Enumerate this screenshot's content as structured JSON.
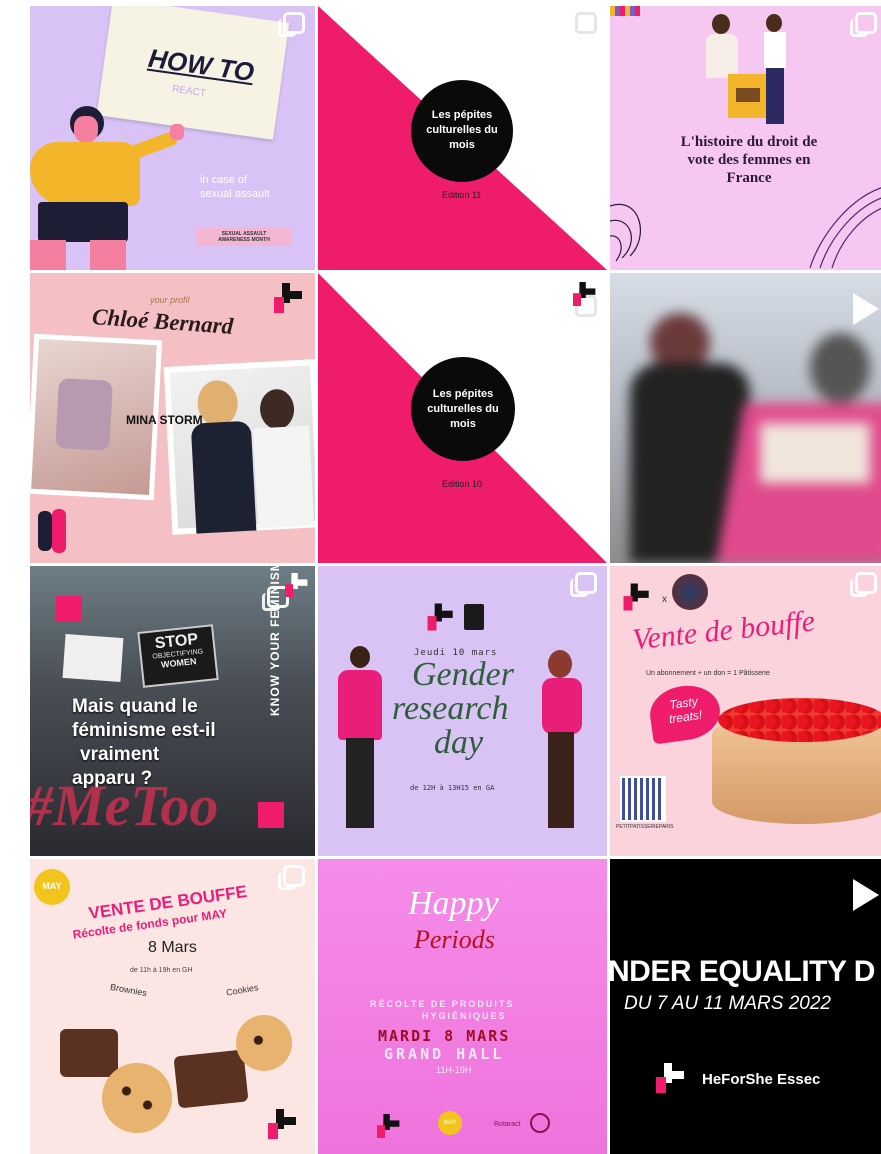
{
  "posts": [
    {
      "title": "HOW TO",
      "sub": "REACT",
      "line1": "in case of",
      "line2": "sexual assault",
      "badge1": "SEXUAL ASSAULT",
      "badge2": "AWARENESS MONTH"
    },
    {
      "title1": "Les pépites",
      "title2": "culturelles du",
      "title3": "mois",
      "edition": "Edition 11"
    },
    {
      "title1": "L'histoire du droit de",
      "title2": "vote des femmes en",
      "title3": "France"
    },
    {
      "kicker": "your profil",
      "name": "Chloé Bernard",
      "tag": "MINA STORM"
    },
    {
      "title1": "Les pépites",
      "title2": "culturelles du",
      "title3": "mois",
      "edition": "Edition 10"
    },
    {},
    {
      "l1": "Mais quand le",
      "l2": "féminisme est-il",
      "l3": "vraiment",
      "l4": "apparu ?",
      "side": "KNOW YOUR FEMINISM",
      "sign1": "STOP",
      "sign2": "OBJECTIFYING",
      "sign3": "WOMEN",
      "bigtag": "#MeToo"
    },
    {
      "date": "Jeudi 10 mars",
      "t1": "Gender",
      "t2": "research",
      "t3": "day",
      "time": "de 12H à 13H15 en GA"
    },
    {
      "title": "Vente de bouffe",
      "sub": "Un abonnement + un don = 1 Pâtisserie",
      "badge1": "Tasty",
      "badge2": "treats!",
      "x": "x",
      "credit": "PETITPATISSERIEPARIS"
    },
    {
      "badge": "MAY",
      "t1": "VENTE DE BOUFFE",
      "t2": "Récolte de fonds pour MAY",
      "date": "8 Mars",
      "time": "de 11h à 19h en GH",
      "lab1": "Brownies",
      "lab2": "Cookies"
    },
    {
      "t1": "Happy",
      "t2": "Periods",
      "s1": "RÉCOLTE DE PRODUITS",
      "s2": "HYGIÉNIQUES",
      "d1": "MARDI 8 MARS",
      "d2": "GRAND HALL",
      "time": "11H-19H",
      "may": "MAY",
      "rot": "Rotaract"
    },
    {
      "t1": "NDER EQUALITY D",
      "t2": "DU 7 AU 11 MARS 2022",
      "brand": "HeForShe Essec"
    }
  ],
  "colors": {
    "pink": "#ef1b6b",
    "lilac": "#d9c3f5",
    "hotpink": "#e91e78"
  }
}
